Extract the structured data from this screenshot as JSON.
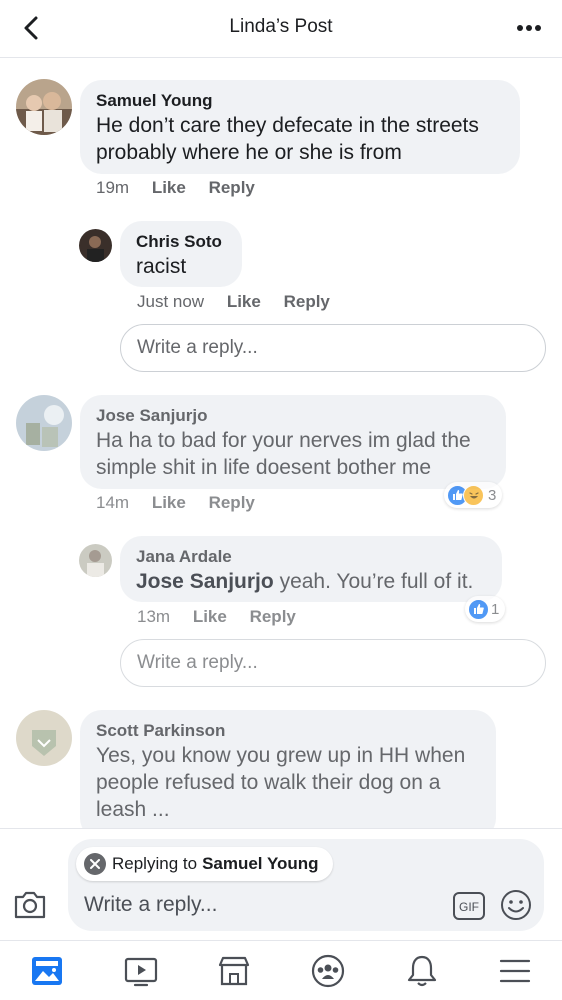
{
  "header": {
    "title": "Linda’s Post"
  },
  "comments": [
    {
      "name": "Samuel Young",
      "text": "He don’t care they defecate in the streets probably where he or she is from",
      "time": "19m",
      "like": "Like",
      "reply": "Reply",
      "replies": [
        {
          "name": "Chris Soto",
          "text": "racist",
          "time": "Just now",
          "like": "Like",
          "reply": "Reply"
        }
      ],
      "reply_placeholder": "Write a reply..."
    },
    {
      "name": "Jose Sanjurjo",
      "text": "Ha ha to bad for your nerves im glad the simple shit in life doesent bother me",
      "time": "14m",
      "like": "Like",
      "reply": "Reply",
      "reaction_count": "3",
      "replies": [
        {
          "name": "Jana Ardale",
          "mention": "Jose Sanjurjo",
          "text": "yeah. You’re full of it.",
          "time": "13m",
          "like": "Like",
          "reply": "Reply",
          "reaction_count": "1"
        }
      ],
      "reply_placeholder": "Write a reply..."
    },
    {
      "name": "Scott Parkinson",
      "text": "Yes, you know you grew up in HH when people refused to walk their dog on a leash ..."
    }
  ],
  "composer": {
    "replying_prefix": "Replying to",
    "replying_name": "Samuel Young",
    "placeholder": "Write a reply..."
  },
  "colors": {
    "accent": "#1877f2",
    "bubble": "#f0f2f5",
    "muted": "#65676b"
  },
  "tabs": [
    "news-feed-icon",
    "watch-icon",
    "marketplace-icon",
    "groups-icon",
    "notifications-icon",
    "menu-icon"
  ]
}
